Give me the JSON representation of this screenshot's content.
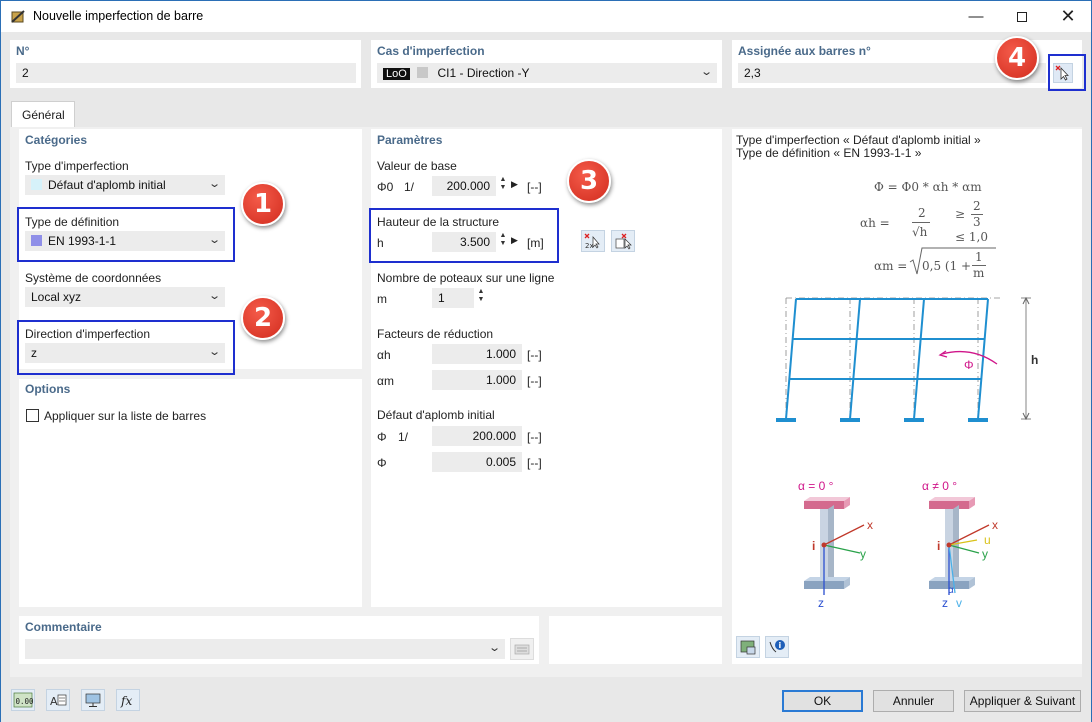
{
  "window": {
    "title": "Nouvelle imperfection de barre"
  },
  "top": {
    "no_label": "N°",
    "no_value": "2",
    "case_label": "Cas d'imperfection",
    "case_tag": "LoO",
    "case_value": "CI1 - Direction -Y",
    "assigned_label": "Assignée aux barres n°",
    "assigned_value": "2,3"
  },
  "tabs": [
    {
      "label": "Général"
    }
  ],
  "categories": {
    "header": "Catégories",
    "imp_type_label": "Type d'imperfection",
    "imp_type_value": "Défaut d'aplomb initial",
    "def_type_label": "Type de définition",
    "def_type_value": "EN 1993-1-1",
    "coord_label": "Système de coordonnées",
    "coord_value": "Local xyz",
    "direction_label": "Direction d'imperfection",
    "direction_value": "z"
  },
  "options": {
    "header": "Options",
    "apply_list_label": "Appliquer sur la liste de barres",
    "apply_list_checked": false
  },
  "parameters": {
    "header": "Paramètres",
    "base_label": "Valeur de base",
    "phi0_sym": "Φ0",
    "phi0_prefix": "1/",
    "phi0_value": "200.000",
    "phi0_unit": "[--]",
    "height_label": "Hauteur de la structure",
    "h_sym": "h",
    "h_value": "3.500",
    "h_unit": "[m]",
    "columns_label": "Nombre de poteaux sur une ligne",
    "m_sym": "m",
    "m_value": "1",
    "reduction_label": "Facteurs de réduction",
    "ah_sym": "αh",
    "ah_value": "1.000",
    "ah_unit": "[--]",
    "am_sym": "αm",
    "am_value": "1.000",
    "am_unit": "[--]",
    "initial_label": "Défaut d'aplomb initial",
    "phi_sym": "Φ",
    "phi_prefix": "1/",
    "phi_value": "200.000",
    "phi_unit": "[--]",
    "phi2_sym": "Φ",
    "phi2_value": "0.005",
    "phi2_unit": "[--]"
  },
  "info": {
    "line1": "Type d'imperfection « Défaut d'aplomb initial »",
    "line2": "Type de définition « EN 1993-1-1 »",
    "f1": "Φ = Φ0 * αh * αm",
    "f2_lhs": "αh =",
    "f2_num": "2",
    "f2_den": "√h",
    "f2_c1": "≥",
    "f2_c1_num": "2",
    "f2_c1_den": "3",
    "f2_c2": "≤ 1,0",
    "f3_lhs": "αm =",
    "f3_rhs": "0,5 (1 +",
    "f3_num": "1",
    "f3_den": "m",
    "h_label": "h",
    "phi_label": "Φ",
    "alpha0": "α = 0 °",
    "alpha_ne": "α ≠ 0 °",
    "ax_x": "x",
    "ax_y": "y",
    "ax_z": "z",
    "ax_i": "i",
    "ax_u": "u",
    "ax_v": "v",
    "ax_alpha": "α"
  },
  "comment": {
    "header": "Commentaire",
    "value": ""
  },
  "buttons": {
    "ok": "OK",
    "cancel": "Annuler",
    "apply_next": "Appliquer & Suivant"
  },
  "badges": [
    "1",
    "2",
    "3",
    "4"
  ],
  "colors": {
    "accent": "#1e2fcf",
    "badge": "#d93a2b",
    "header": "#4a6a8a",
    "structure": "#1f8fd0",
    "magenta": "#d0168a"
  }
}
